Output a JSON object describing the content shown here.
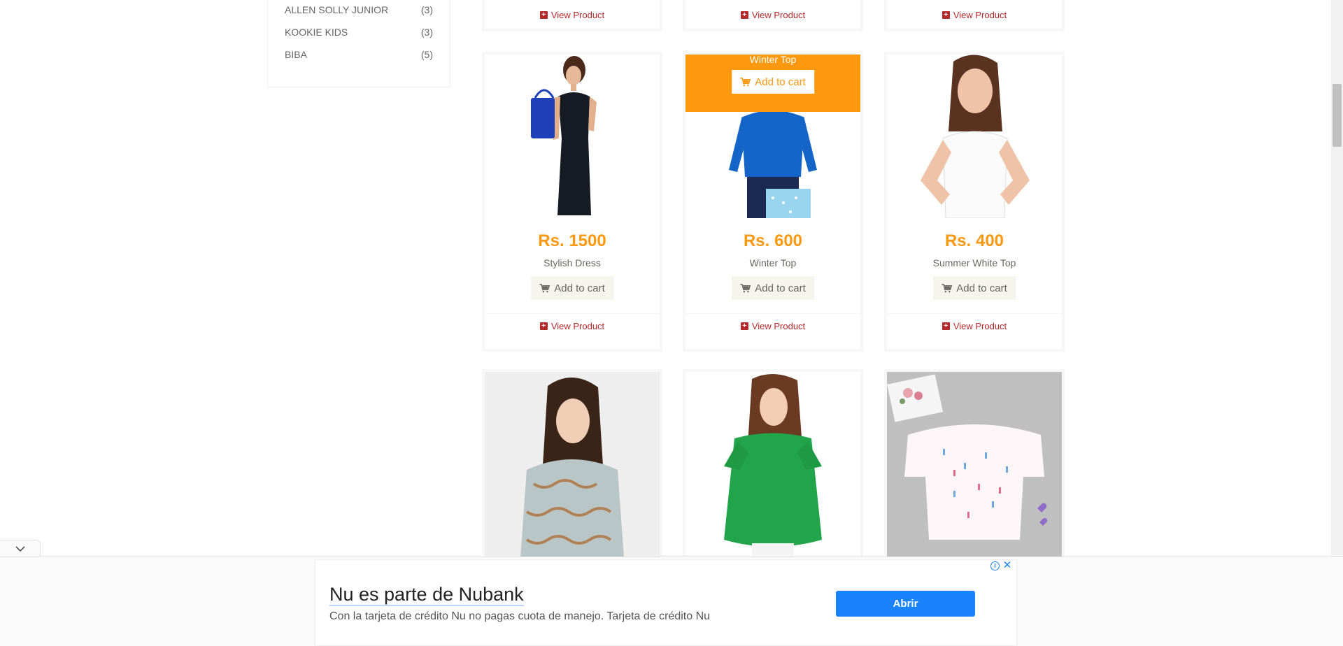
{
  "brands": [
    {
      "name": "ALLEN SOLLY JUNIOR",
      "count": "(3)"
    },
    {
      "name": "KOOKIE KIDS",
      "count": "(3)"
    },
    {
      "name": "BIBA",
      "count": "(5)"
    }
  ],
  "top_row": [
    {
      "view_label": "View Product"
    },
    {
      "view_label": "View Product"
    },
    {
      "view_label": "View Product"
    }
  ],
  "products": [
    {
      "price": "Rs. 1500",
      "name": "Stylish Dress",
      "add_label": "Add to cart",
      "view_label": "View Product"
    },
    {
      "price": "Rs. 600",
      "name": "Winter Top",
      "add_label": "Add to cart",
      "view_label": "View Product"
    },
    {
      "price": "Rs. 400",
      "name": "Summer White Top",
      "add_label": "Add to cart",
      "view_label": "View Product"
    }
  ],
  "hover_overlay": {
    "title": "Winter Top",
    "add_label": "Add to cart"
  },
  "ad": {
    "title": "Nu es parte de Nubank",
    "description": "Con la tarjeta de crédito Nu no pagas cuota de manejo. Tarjeta de crédito Nu",
    "button": "Abrir",
    "info_icon": "ⓘ",
    "close_icon": "✕"
  },
  "colors": {
    "accent": "#fe980f",
    "link": "#b4292c",
    "ad_button": "#1a82fb"
  }
}
